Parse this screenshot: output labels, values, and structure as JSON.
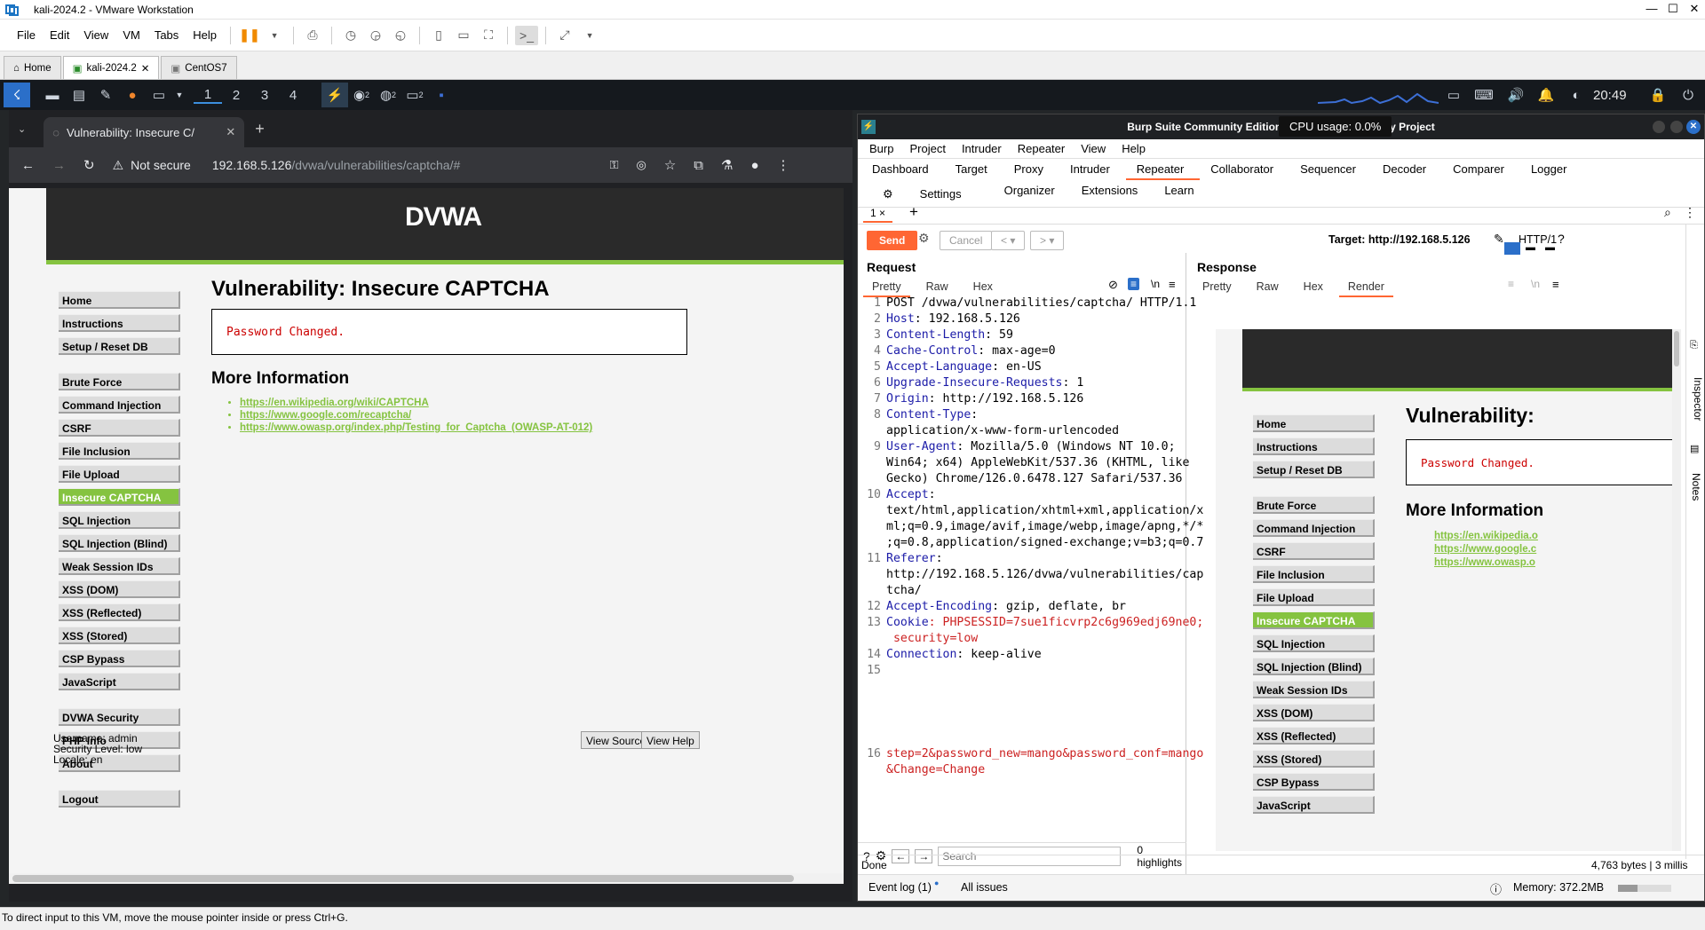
{
  "vm": {
    "title": "kali-2024.2 - VMware Workstation",
    "menu": [
      "File",
      "Edit",
      "View",
      "VM",
      "Tabs",
      "Help"
    ],
    "tabs": [
      "Home",
      "kali-2024.2",
      "CentOS7"
    ],
    "status": "To direct input to this VM, move the mouse pointer inside or press Ctrl+G."
  },
  "kali": {
    "workspaces": [
      "1",
      "2",
      "3",
      "4"
    ],
    "clock": "20:49",
    "badges": [
      "2",
      "2",
      "2"
    ]
  },
  "chrome": {
    "tab_title": "Vulnerability: Insecure C/",
    "not_secure": "Not secure",
    "url_host": "192.168.5.126",
    "url_path": "/dvwa/vulnerabilities/captcha/#"
  },
  "dvwa": {
    "logo": "DVWA",
    "menu_group1": [
      "Home",
      "Instructions",
      "Setup / Reset DB"
    ],
    "menu_group2": [
      "Brute Force",
      "Command Injection",
      "CSRF",
      "File Inclusion",
      "File Upload",
      "Insecure CAPTCHA",
      "SQL Injection",
      "SQL Injection (Blind)",
      "Weak Session IDs",
      "XSS (DOM)",
      "XSS (Reflected)",
      "XSS (Stored)",
      "CSP Bypass",
      "JavaScript"
    ],
    "menu_group3": [
      "DVWA Security",
      "PHP Info",
      "About"
    ],
    "menu_group4": [
      "Logout"
    ],
    "selected": "Insecure CAPTCHA",
    "page_title": "Vulnerability: Insecure CAPTCHA",
    "message": "Password Changed.",
    "more_info": "More Information",
    "links": [
      "https://en.wikipedia.org/wiki/CAPTCHA",
      "https://www.google.com/recaptcha/",
      "https://www.owasp.org/index.php/Testing_for_Captcha_(OWASP-AT-012)"
    ],
    "username": "Username: admin",
    "security": "Security Level: low",
    "locale": "Locale: en",
    "view_source": "View Source",
    "view_help": "View Help"
  },
  "burp": {
    "title": "Burp Suite Community Edition v2024.5.5 - Temporary Project",
    "cpu_tooltip": "CPU usage: 0.0%",
    "menu": [
      "Burp",
      "Project",
      "Intruder",
      "Repeater",
      "View",
      "Help"
    ],
    "tabs_row1": [
      "Dashboard",
      "Target",
      "Proxy",
      "Intruder",
      "Repeater",
      "Collaborator",
      "Sequencer",
      "Decoder",
      "Comparer",
      "Logger",
      "Settings"
    ],
    "tabs_row2": [
      "Organizer",
      "Extensions",
      "Learn"
    ],
    "active_tab": "Repeater",
    "repeater_tab": "1 ×",
    "send": "Send",
    "cancel": "Cancel",
    "target": "Target: http://192.168.5.126",
    "http_version": "HTTP/1",
    "request_label": "Request",
    "response_label": "Response",
    "request_tabs": [
      "Pretty",
      "Raw",
      "Hex"
    ],
    "response_tabs": [
      "Pretty",
      "Raw",
      "Hex",
      "Render"
    ],
    "side_tabs": [
      "Inspector",
      "Notes"
    ],
    "search_placeholder": "Search",
    "highlights": "0 highlights",
    "status_done": "Done",
    "response_meta": "4,763 bytes | 3 millis",
    "event_log": "Event log (1)",
    "all_issues": "All issues",
    "memory": "Memory: 372.2MB",
    "request_lines": [
      {
        "n": "1",
        "k": "POST /dvwa/vulnerabilities/captcha/ HTTP/1.1",
        "v": ""
      },
      {
        "n": "2",
        "k": "Host",
        "v": ": 192.168.5.126"
      },
      {
        "n": "3",
        "k": "Content-Length",
        "v": ": 59"
      },
      {
        "n": "4",
        "k": "Cache-Control",
        "v": ": max-age=0"
      },
      {
        "n": "5",
        "k": "Accept-Language",
        "v": ": en-US"
      },
      {
        "n": "6",
        "k": "Upgrade-Insecure-Requests",
        "v": ": 1"
      },
      {
        "n": "7",
        "k": "Origin",
        "v": ": http://192.168.5.126"
      },
      {
        "n": "8",
        "k": "Content-Type",
        "v": ":"
      },
      {
        "n": "",
        "k": "",
        "v": "application/x-www-form-urlencoded"
      },
      {
        "n": "9",
        "k": "User-Agent",
        "v": ": Mozilla/5.0 (Windows NT 10.0;"
      },
      {
        "n": "",
        "k": "",
        "v": "Win64; x64) AppleWebKit/537.36 (KHTML, like"
      },
      {
        "n": "",
        "k": "",
        "v": "Gecko) Chrome/126.0.6478.127 Safari/537.36"
      },
      {
        "n": "10",
        "k": "Accept",
        "v": ":"
      },
      {
        "n": "",
        "k": "",
        "v": "text/html,application/xhtml+xml,application/x"
      },
      {
        "n": "",
        "k": "",
        "v": "ml;q=0.9,image/avif,image/webp,image/apng,*/*"
      },
      {
        "n": "",
        "k": "",
        "v": ";q=0.8,application/signed-exchange;v=b3;q=0.7"
      },
      {
        "n": "11",
        "k": "Referer",
        "v": ":"
      },
      {
        "n": "",
        "k": "",
        "v": "http://192.168.5.126/dvwa/vulnerabilities/cap"
      },
      {
        "n": "",
        "k": "",
        "v": "tcha/"
      },
      {
        "n": "12",
        "k": "Accept-Encoding",
        "v": ": gzip, deflate, br"
      },
      {
        "n": "13",
        "k": "Cookie",
        "v": ": PHPSESSID=7sue1ficvrp2c6g969edj69ne0;"
      },
      {
        "n": "",
        "k": "",
        "v": " security=low"
      },
      {
        "n": "14",
        "k": "Connection",
        "v": ": keep-alive"
      },
      {
        "n": "15",
        "k": "",
        "v": ""
      }
    ],
    "body_line1": "step=2&password_new=mango&password_conf=mango",
    "body_line2": "&Change=Change",
    "render_menu": [
      "Home",
      "Instructions",
      "Setup / Reset DB",
      "Brute Force",
      "Command Injection",
      "CSRF",
      "File Inclusion",
      "File Upload",
      "Insecure CAPTCHA",
      "SQL Injection",
      "SQL Injection (Blind)",
      "Weak Session IDs",
      "XSS (DOM)",
      "XSS (Reflected)",
      "XSS (Stored)",
      "CSP Bypass",
      "JavaScript"
    ],
    "render_title": "Vulnerability:",
    "render_links": [
      "https://en.wikipedia.o",
      "https://www.google.c",
      "https://www.owasp.o"
    ]
  },
  "colors": {
    "dvwa_green": "#85c340",
    "burp_orange": "#ff6633",
    "chrome_dark": "#202124"
  }
}
